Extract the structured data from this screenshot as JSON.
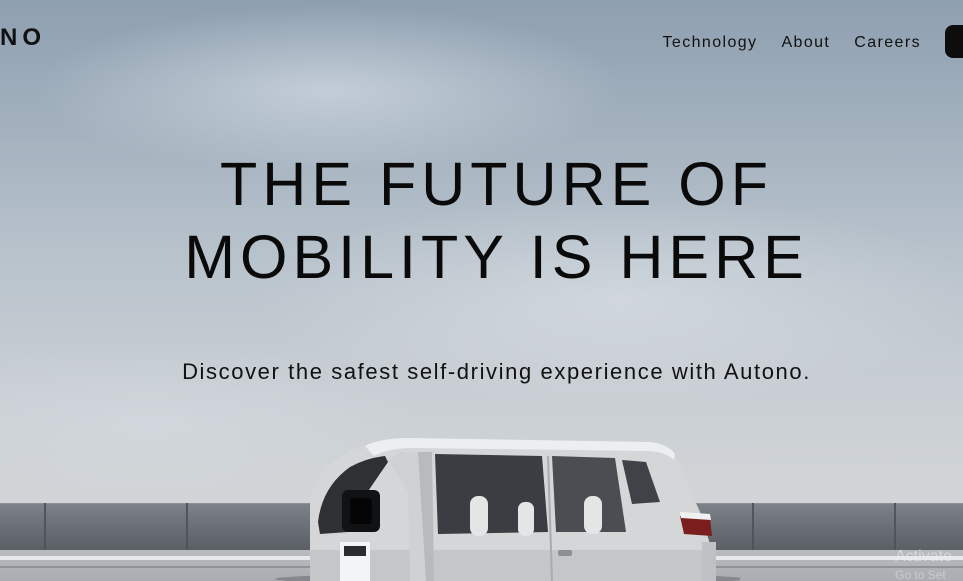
{
  "header": {
    "logo": "NO",
    "nav": [
      "Technology",
      "About",
      "Careers"
    ]
  },
  "hero": {
    "headline_line1": "THE FUTURE OF",
    "headline_line2": "MOBILITY IS HERE",
    "subheadline": "Discover the safest self-driving experience with Autono."
  },
  "os_watermark": {
    "line1": "Activate",
    "line2": "Go to Set"
  },
  "colors": {
    "text": "#0a0a0a",
    "cta_button": "#0d0d0d",
    "sky_top": "#8e9fb0",
    "sky_bottom": "#d6d8da"
  }
}
